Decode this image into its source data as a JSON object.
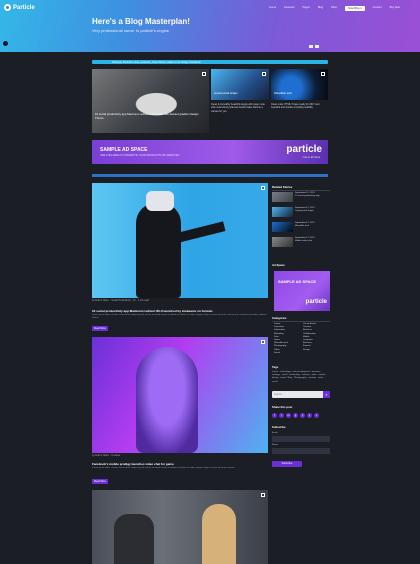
{
  "header": {
    "logo_text": "Particle",
    "nav": [
      "Home",
      "Features",
      "Pages",
      "Blog",
      "Shop",
      "Grav Blog ▾",
      "Contact",
      "Buy Now"
    ],
    "title": "Here's a Blog Masterplan!",
    "subtitle": "Very professional name. Is particle's engine."
  },
  "ticker": {
    "text": "Discover Particle's new, exclusive, Grav theme made to our design standards"
  },
  "featured": {
    "tile1_caption": "10 social productivity app Maximum redirects with lower the deleted gradient design Theme",
    "tile2_caption": "Liquid portal shape",
    "tile3_caption": "Wearable tech",
    "tile2_text": "Clean & incredibly beautiful design with clean code and meticulously planned details make Particle a canvas for you",
    "tile3_text": "Clean code: HTML 5 base ready for 2017 and beautiful and intuitive including usability"
  },
  "ad_banner": {
    "line1": "SAMPLE AD SPACE",
    "line2": "USE THIS AREA TO PROMOTE YOUR PRODUCTS OR SERVICES",
    "brand": "particle",
    "brand_sub": "now in all sizes"
  },
  "posts": [
    {
      "meta": "by Author Name · Social Productivity · 12 · 1 min read",
      "title": "10 social productivity app Maximum redirect Wi-fi launched by lowbeams on formats",
      "excerpt": "Lorem ipsum dolor sit amet consectetur adipiscing elit sed do eiusmod tempor incididunt ut labore et dolore magna aliqua ut enim ad minim veniam quis nostrud exercitation ullamco laboris",
      "button": "Read More"
    },
    {
      "meta": "by Author Name · Creative",
      "title": "Facebook's mobile prodigy launches video chat for game",
      "excerpt": "Lorem ipsum dolor sit amet consectetur adipiscing elit sed do eiusmod tempor incididunt ut labore et dolore magna aliqua ut enim ad minim veniam",
      "button": "Read More"
    }
  ],
  "sidebar": {
    "related_title": "Related Stories",
    "related": [
      {
        "date": "September 12, 2017",
        "title": "10 social productivity app"
      },
      {
        "date": "September 12, 2017",
        "title": "Liquid portal shape"
      },
      {
        "date": "September 12, 2017",
        "title": "Wearable tech"
      },
      {
        "date": "September 12, 2017",
        "title": "Mobile video chat"
      }
    ],
    "ad_title": "Ad Space",
    "ad_line1": "SAMPLE AD SPACE",
    "ad_brand": "particle",
    "categories_title": "Categories",
    "categories_left": [
      "Lorem",
      "Innovation",
      "Information",
      "Marketing",
      "Data",
      "Gears",
      "Wearable tech",
      "Photography",
      "Video",
      "Social"
    ],
    "categories_right": [
      "Circuit Board",
      "Creative",
      "Business",
      "Collaboration",
      "Mobile",
      "Computer",
      "Business",
      "Finance",
      "Design"
    ],
    "tags_title": "Tags",
    "tags_text": "Lorem · technology · web development · business · strategy · social · networking · industry · video · market · design · travel · Blog · Photography · startups · news · social",
    "search_placeholder": "Search...",
    "social_title": "Share this post",
    "socials": [
      "f",
      "t",
      "in",
      "g",
      "p",
      "y",
      "v"
    ],
    "subscribe_title": "Subscribe",
    "email_label": "Email",
    "name_label": "Name",
    "subscribe_button": "Subscribe"
  }
}
